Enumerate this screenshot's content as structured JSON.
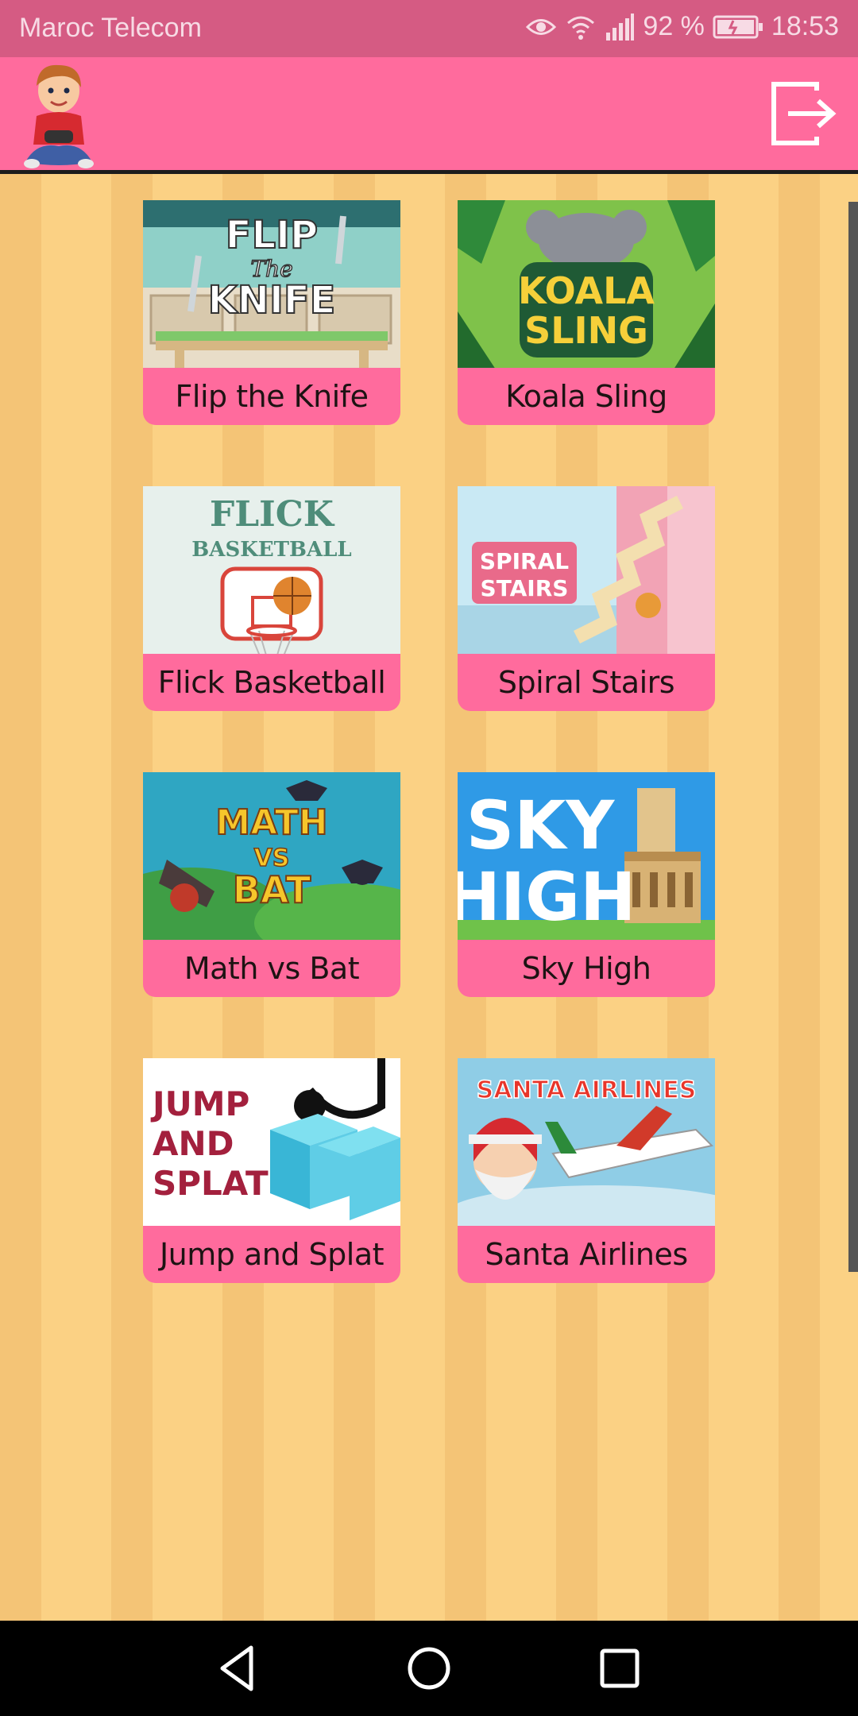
{
  "status_bar": {
    "carrier": "Maroc Telecom",
    "battery": "92 %",
    "time": "18:53",
    "icons": [
      "eye-comfort-icon",
      "wifi-icon",
      "signal-icon",
      "battery-icon"
    ]
  },
  "app_bar": {
    "avatar_icon": "boy-gamer-avatar",
    "exit_icon": "exit-icon",
    "colors": {
      "bar": "#ff6b9d",
      "status": "#d55b83"
    }
  },
  "games": [
    {
      "title": "Flip the Knife",
      "thumb_text": [
        "FLIP",
        "The",
        "KNIFE"
      ]
    },
    {
      "title": "Koala Sling",
      "thumb_text": [
        "KOALA",
        "SLING"
      ]
    },
    {
      "title": "Flick Basketball",
      "thumb_text": [
        "FLICK",
        "BASKETBALL"
      ]
    },
    {
      "title": "Spiral Stairs",
      "thumb_text": [
        "SPIRAL",
        "STAIRS"
      ]
    },
    {
      "title": "Math vs Bat",
      "thumb_text": [
        "MATH",
        "VS",
        "BAT"
      ]
    },
    {
      "title": "Sky High",
      "thumb_text": [
        "SKY",
        "HIGH"
      ]
    },
    {
      "title": "Jump and Splat",
      "thumb_text": [
        "JUMP",
        "AND",
        "SPLAT"
      ]
    },
    {
      "title": "Santa Airlines",
      "thumb_text": [
        "SANTA AIRLINES"
      ]
    }
  ],
  "nav_bar": {
    "icons": [
      "back-icon",
      "home-icon",
      "recents-icon"
    ]
  }
}
